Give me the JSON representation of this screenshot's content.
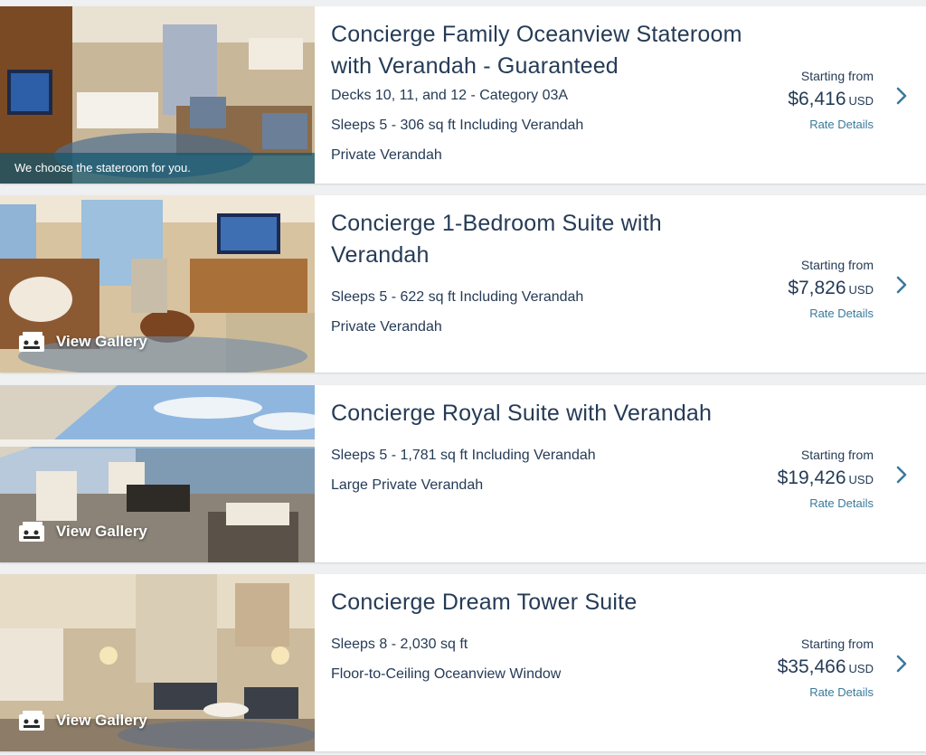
{
  "staterooms": [
    {
      "title_line1": "Concierge Family Oceanview Stateroom",
      "title_line2": "with Verandah - Guaranteed",
      "details": [
        "Decks 10, 11, and 12 - Category 03A",
        "Sleeps 5 - 306 sq ft Including Verandah",
        "Private Verandah"
      ],
      "image_caption": "We choose the stateroom for you.",
      "starting_label": "Starting from",
      "price": "$6,416",
      "currency": "USD",
      "rate_details_label": "Rate Details"
    },
    {
      "title_line1": "Concierge 1-Bedroom Suite with Verandah",
      "details": [
        "Sleeps 5 - 622 sq ft Including Verandah",
        "Private Verandah"
      ],
      "gallery_label": "View Gallery",
      "starting_label": "Starting from",
      "price": "$7,826",
      "currency": "USD",
      "rate_details_label": "Rate Details"
    },
    {
      "title_line1": "Concierge Royal Suite with Verandah",
      "details": [
        "Sleeps 5 - 1,781 sq ft Including Verandah",
        "Large Private Verandah"
      ],
      "gallery_label": "View Gallery",
      "starting_label": "Starting from",
      "price": "$19,426",
      "currency": "USD",
      "rate_details_label": "Rate Details"
    },
    {
      "title_line1": "Concierge Dream Tower Suite",
      "details": [
        "Sleeps 8 - 2,030 sq ft",
        "Floor-to-Ceiling Oceanview Window"
      ],
      "gallery_label": "View Gallery",
      "starting_label": "Starting from",
      "price": "$35,466",
      "currency": "USD",
      "rate_details_label": "Rate Details"
    }
  ],
  "icons": {
    "gallery": "gallery-icon",
    "chevron": "chevron-right-icon"
  },
  "colors": {
    "text": "#253b56",
    "link": "#3a7a9c",
    "caption_overlay": "#12566e"
  }
}
